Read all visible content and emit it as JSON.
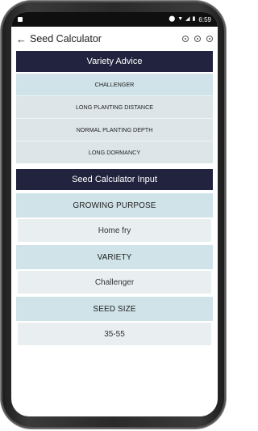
{
  "status_bar": {
    "time": "6:59",
    "icons": [
      "notification-icon",
      "location-icon",
      "wifi-icon",
      "signal-icon",
      "battery-icon"
    ]
  },
  "app_bar": {
    "back_icon": "←",
    "title": "Seed Calculator",
    "actions": [
      "settings-icon",
      "record-icon",
      "info-icon"
    ]
  },
  "variety_advice": {
    "header": "Variety Advice",
    "items": [
      "CHALLENGER",
      "LONG PLANTING DISTANCE",
      "NORMAL PLANTING DEPTH",
      "LONG DORMANCY"
    ]
  },
  "calculator_input": {
    "header": "Seed Calculator Input",
    "fields": [
      {
        "label": "GROWING PURPOSE",
        "value": "Home fry"
      },
      {
        "label": "VARIETY",
        "value": "Challenger"
      },
      {
        "label": "SEED SIZE",
        "value": "35-55"
      }
    ]
  },
  "colors": {
    "header_bg": "#22243f",
    "label_bg": "#cfe3e9",
    "value_bg": "#e9eef1"
  }
}
